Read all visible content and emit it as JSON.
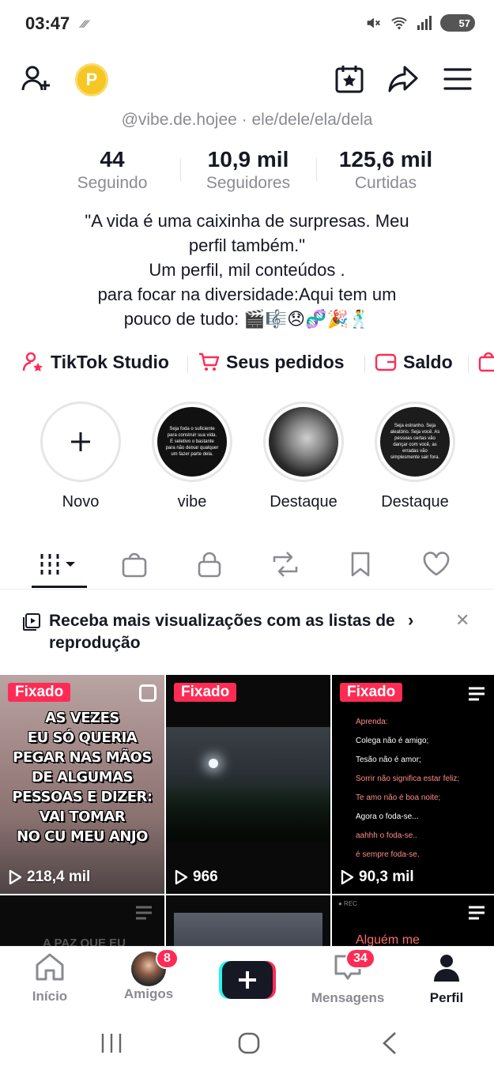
{
  "status": {
    "time": "03:47",
    "battery": "57"
  },
  "profile": {
    "handle_line": "@vibe.de.hojee · ele/dele/ela/dela"
  },
  "stats": [
    {
      "value": "44",
      "label": "Seguindo"
    },
    {
      "value": "10,9 mil",
      "label": "Seguidores"
    },
    {
      "value": "125,6 mil",
      "label": "Curtidas"
    }
  ],
  "bio": [
    "\"A vida é uma caixinha de surpresas. Meu",
    "perfil também.\"",
    "Um perfil, mil conteúdos .",
    "para focar na diversidade:Aqui tem um",
    "pouco de tudo: 🎬🎼😞🧬🎉🕺"
  ],
  "links": [
    {
      "label": "TikTok Studio",
      "icon": "person-star-icon"
    },
    {
      "label": "Seus pedidos",
      "icon": "cart-icon"
    },
    {
      "label": "Saldo",
      "icon": "wallet-icon"
    }
  ],
  "highlights": [
    {
      "label": "Novo"
    },
    {
      "label": "vibe",
      "snippet": "Seja foda o suficiente para construir sua vida. E seletivo o bastante para não deixar qualquer um fazer parte dela."
    },
    {
      "label": "Destaque"
    },
    {
      "label": "Destaque",
      "snippet": "Seja estranho. Seja aleatório. Seja você. As pessoas certas vão dançar com você, as erradas vão simplesmente sair fora."
    }
  ],
  "promo": {
    "text": "Receba mais visualizações com as listas de reprodução"
  },
  "videos": [
    {
      "pinned": "Fixado",
      "views": "218,4 mil",
      "overlay": [
        "AS VEZES",
        "EU SÓ QUERIA",
        "PEGAR NAS MÃOS",
        "DE ALGUMAS",
        "PESSOAS E DIZER:",
        "VAI TOMAR",
        "NO CU MEU ANJO"
      ]
    },
    {
      "pinned": "Fixado",
      "views": "966"
    },
    {
      "pinned": "Fixado",
      "views": "90,3 mil",
      "overlay": [
        "Aprenda:",
        "Colega não é amigo;",
        "Tesão não é amor;",
        "Sorrir não significa estar feliz;",
        "Te amo não é boa noite;",
        "Agora o foda-se...",
        "aahhh o foda-se..",
        "é sempre foda-se."
      ]
    },
    {
      "overlay": [
        "A PAZ QUE EU"
      ]
    },
    {},
    {
      "overlay": [
        "Alguém me"
      ]
    }
  ],
  "nav": {
    "home": "Início",
    "friends": "Amigos",
    "friends_badge": "8",
    "messages": "Mensagens",
    "messages_badge": "34",
    "profile": "Perfil"
  },
  "colors": {
    "accent": "#fe2c55",
    "coin": "#f6c623",
    "text": "#161823",
    "muted": "#8a8b91"
  }
}
